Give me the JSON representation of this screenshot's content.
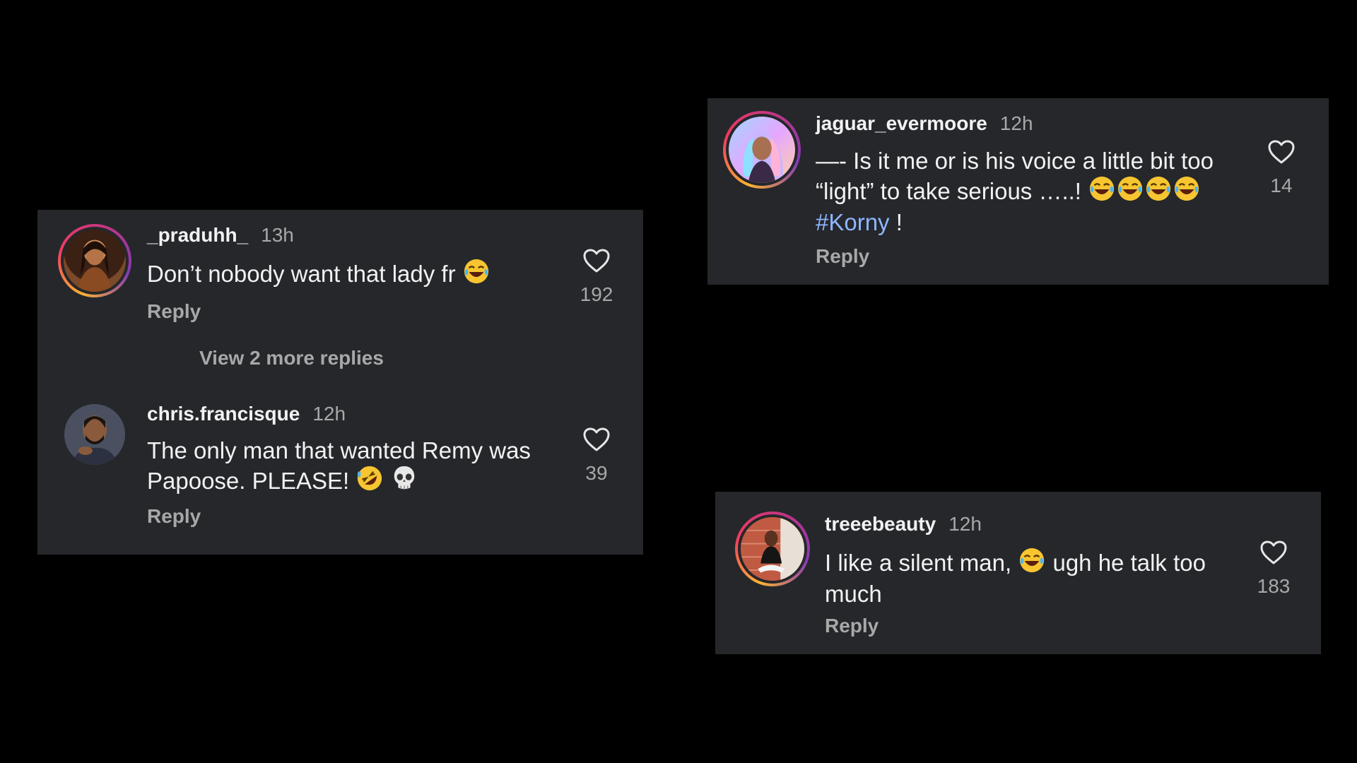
{
  "comments": [
    {
      "username": "_praduhh_",
      "time": "13h",
      "text": "Don’t nobody want that lady fr",
      "likes": "192",
      "reply_label": "Reply",
      "story_ring": true
    },
    {
      "username": "chris.francisque",
      "time": "12h",
      "text_line1": "The only man that wanted Remy was",
      "text_line2": "Papoose. PLEASE!",
      "likes": "39",
      "reply_label": "Reply",
      "story_ring": false
    },
    {
      "username": "jaguar_evermoore",
      "time": "12h",
      "text_line1": "—- Is it me or is his voice a little bit too",
      "text_line2": "“light” to take serious …..!",
      "hashtag": "#Korny",
      "text_tail": " !",
      "likes": "14",
      "reply_label": "Reply",
      "story_ring": true
    },
    {
      "username": "treeebeauty",
      "time": "12h",
      "text_pre": "I like a silent man,",
      "text_post": " ugh he talk too",
      "text_line2": "much",
      "likes": "183",
      "reply_label": "Reply",
      "story_ring": true
    }
  ],
  "view_more_replies": "View 2 more replies",
  "icons": {
    "like": "heart-outline-icon",
    "laugh": "face-with-tears-of-joy-emoji",
    "rofl": "rolling-on-the-floor-laughing-emoji",
    "skull": "skull-emoji"
  },
  "colors": {
    "background": "#000000",
    "card": "#25272b",
    "text": "#f2f2f2",
    "muted": "#a8a8a8",
    "hashtag": "#8fb6ff"
  }
}
